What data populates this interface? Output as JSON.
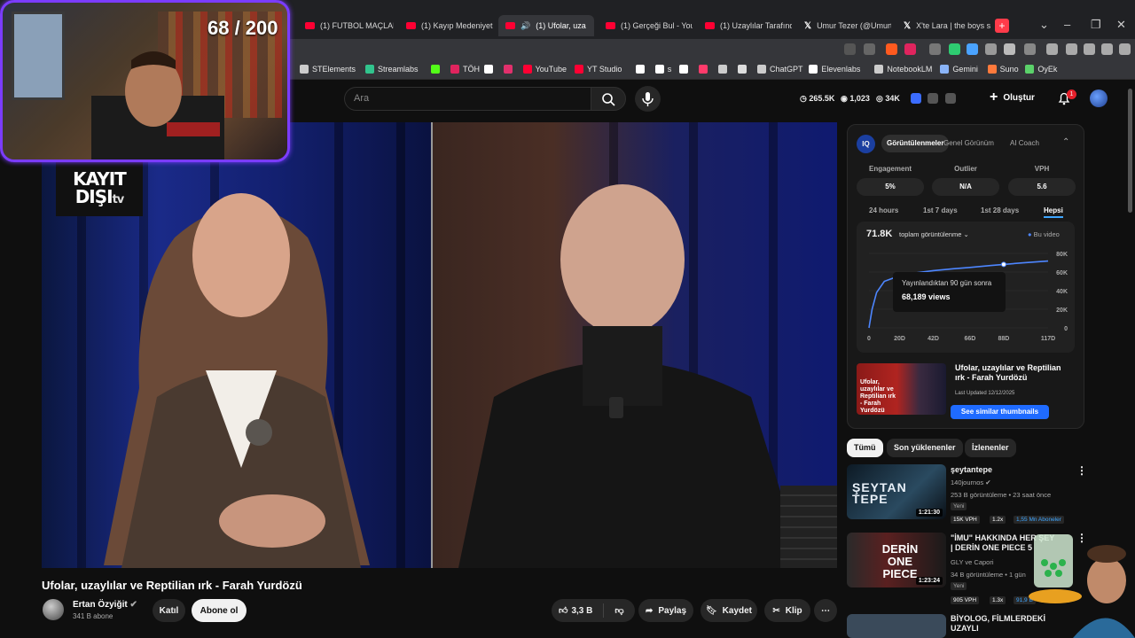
{
  "browser": {
    "tabs": [
      {
        "label": "(1) FUTBOL MAÇLARI",
        "icon": "youtube-icon",
        "active": false
      },
      {
        "label": "(1) Kayıp Medeniyet T",
        "icon": "youtube-icon",
        "active": false
      },
      {
        "label": "(1) Ufolar, uza",
        "icon": "youtube-icon",
        "active": true
      },
      {
        "label": "(1) Gerçeği Bul - YouT",
        "icon": "youtube-icon",
        "active": false
      },
      {
        "label": "(1) Uzaylılar Tarafında",
        "icon": "youtube-icon",
        "active": false
      },
      {
        "label": "Umur Tezer (@Umurt",
        "icon": "x-icon",
        "active": false
      },
      {
        "label": "X'te Lara | the boys s",
        "icon": "x-icon",
        "active": false
      }
    ],
    "bookmarks": [
      {
        "label": "STElements",
        "color": "#cccccc"
      },
      {
        "label": "Streamlabs",
        "color": "#31c48d"
      },
      {
        "label": "",
        "color": "#53fc18"
      },
      {
        "label": "TÖH",
        "color": "#e0245e"
      },
      {
        "label": "",
        "color": "#ffffff"
      },
      {
        "label": "",
        "color": "#e1306c"
      },
      {
        "label": "YouTube",
        "color": "#ff0033"
      },
      {
        "label": "YT Studio",
        "color": "#ff0033"
      },
      {
        "label": "",
        "color": "#ffffff"
      },
      {
        "label": "s",
        "color": "#ffffff"
      },
      {
        "label": "",
        "color": "#ffffff"
      },
      {
        "label": "",
        "color": "#ff3b6b"
      },
      {
        "label": "",
        "color": "#cccccc"
      },
      {
        "label": "",
        "color": "#dddddd"
      },
      {
        "label": "ChatGPT",
        "color": "#cccccc"
      },
      {
        "label": "Elevenlabs",
        "color": "#ffffff"
      },
      {
        "label": "NotebookLM",
        "color": "#cccccc"
      },
      {
        "label": "Gemini",
        "color": "#8ab4f8"
      },
      {
        "label": "Suno",
        "color": "#ff7a3c"
      },
      {
        "label": "OyEk",
        "color": "#5bd16a"
      }
    ]
  },
  "youtube": {
    "search_placeholder": "Ara",
    "header_stats": {
      "views": "265.5K",
      "subs": "1,023",
      "watch": "34K"
    },
    "create_label": "Oluştur",
    "notif_count": "1"
  },
  "video": {
    "overlay_logo_line1": "KAYIT",
    "overlay_logo_line2": "DIŞI",
    "overlay_logo_suffix": "tv",
    "title": "Ufolar, uzaylılar ve Reptilian ırk - Farah Yurdözü",
    "channel": "Ertan Özyiğit",
    "subscribers": "341 B abone",
    "join_label": "Katıl",
    "subscribe_label": "Abone ol",
    "likes": "3,3 B",
    "share_label": "Paylaş",
    "save_label": "Kaydet",
    "clip_label": "Klip"
  },
  "vidiq": {
    "tabs": [
      "Görüntülenmeler",
      "Genel Görünüm",
      "AI Coach"
    ],
    "metrics": [
      {
        "label": "Engagement",
        "value": "5%"
      },
      {
        "label": "Outlier",
        "value": "N/A"
      },
      {
        "label": "VPH",
        "value": "5.6"
      }
    ],
    "ranges": [
      "24 hours",
      "1st 7 days",
      "1st 28 days",
      "Hepsi"
    ],
    "active_range": "Hepsi",
    "total_views": "71.8K",
    "metric_select": "toplam görüntülenme",
    "legend": "Bu video",
    "tooltip_line1": "Yayınlandıktan 90 gün sonra",
    "tooltip_line2": "68,189 views",
    "card_title": "Ufolar, uzaylılar ve Reptilian ırk - Farah Yurdözü",
    "card_updated": "Last Updated 12/12/2025",
    "see_thumbs": "See similar thumbnails"
  },
  "chart_data": {
    "type": "line",
    "x": [
      0,
      2,
      5,
      10,
      20,
      30,
      42,
      55,
      66,
      80,
      88,
      100,
      117
    ],
    "series": [
      {
        "values": [
          0,
          20000,
          38000,
          50000,
          56000,
          59000,
          61500,
          63500,
          65000,
          67000,
          68189,
          69800,
          71800
        ]
      }
    ],
    "xticks": [
      "0",
      "20D",
      "42D",
      "66D",
      "88D",
      "117D"
    ],
    "xtick_values": [
      0,
      20,
      42,
      66,
      88,
      117
    ],
    "yticks": [
      "0",
      "20K",
      "40K",
      "60K",
      "80K"
    ],
    "ytick_values": [
      0,
      20000,
      40000,
      60000,
      80000
    ],
    "xlim": [
      0,
      117
    ],
    "ylim": [
      0,
      80000
    ],
    "highlight_x": 88,
    "highlight_y": 68189,
    "line_color": "#4d86ff"
  },
  "recs": {
    "chips": [
      "Tümü",
      "Son yüklenenler",
      "İzlenenler"
    ],
    "items": [
      {
        "title": "şeytantepe",
        "channel": "140journos",
        "meta": "253 B görüntüleme • 23 saat önce",
        "badge": "Yeni",
        "vph": "15K VPH",
        "x": "1.2x",
        "extra": "1,55 Mn Aboneler",
        "duration": "1:21:30",
        "thumb_text": "ŞEYTAN TEPE"
      },
      {
        "title": "\"İMU\" HAKKINDA HER ŞEY | DERİN ONE PIECE 5",
        "channel": "GLY ve Capori",
        "meta": "34 B görüntüleme • 1 gün",
        "badge": "Yeni",
        "vph": "905 VPH",
        "x": "1.3x",
        "extra": "91,9 B",
        "duration": "1:23:24",
        "thumb_text": "DERİN ONE PIECE"
      },
      {
        "title": "BİYOLOG, FİLMLERDEKİ UZAYLI"
      }
    ]
  },
  "stream": {
    "counter": "68 / 200"
  }
}
